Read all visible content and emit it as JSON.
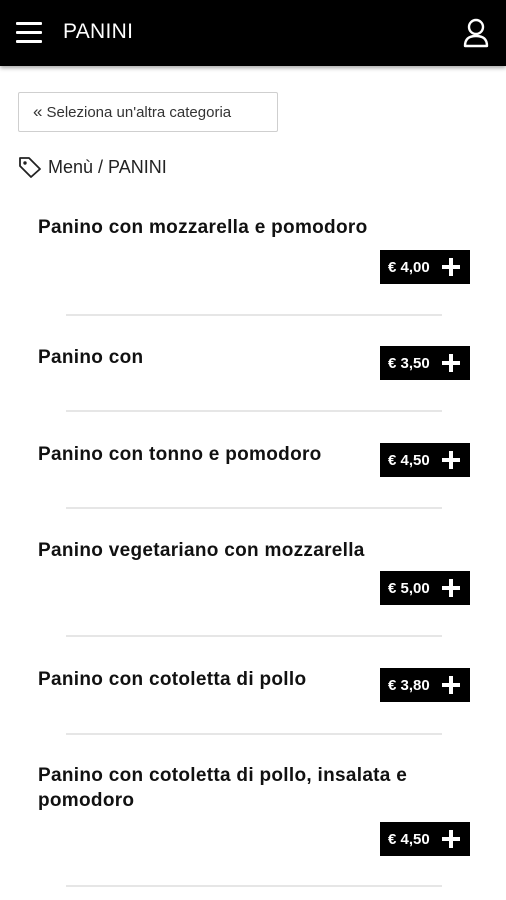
{
  "header": {
    "title": "PANINI"
  },
  "nav": {
    "back_label": "Seleziona un'altra categoria",
    "breadcrumb": "Menù / PANINI"
  },
  "items": [
    {
      "name": "Panino con mozzarella e pomodoro",
      "price": "€ 4,00"
    },
    {
      "name": "Panino con",
      "price": "€ 3,50"
    },
    {
      "name": "Panino con tonno e pomodoro",
      "price": "€ 4,50"
    },
    {
      "name": "Panino vegetariano con mozzarella",
      "price": "€ 5,00"
    },
    {
      "name": "Panino con cotoletta di pollo",
      "price": "€ 3,80"
    },
    {
      "name": "Panino con cotoletta di pollo, insalata e pomodoro",
      "price": "€ 4,50"
    }
  ],
  "icons": {
    "menu": "hamburger-menu-icon",
    "user": "user-icon",
    "back": "double-chevron-left-icon",
    "breadcrumb": "tag-icon",
    "add": "plus-icon"
  },
  "colors": {
    "header_bg": "#000000",
    "price_bg": "#000000",
    "text": "#111111"
  }
}
